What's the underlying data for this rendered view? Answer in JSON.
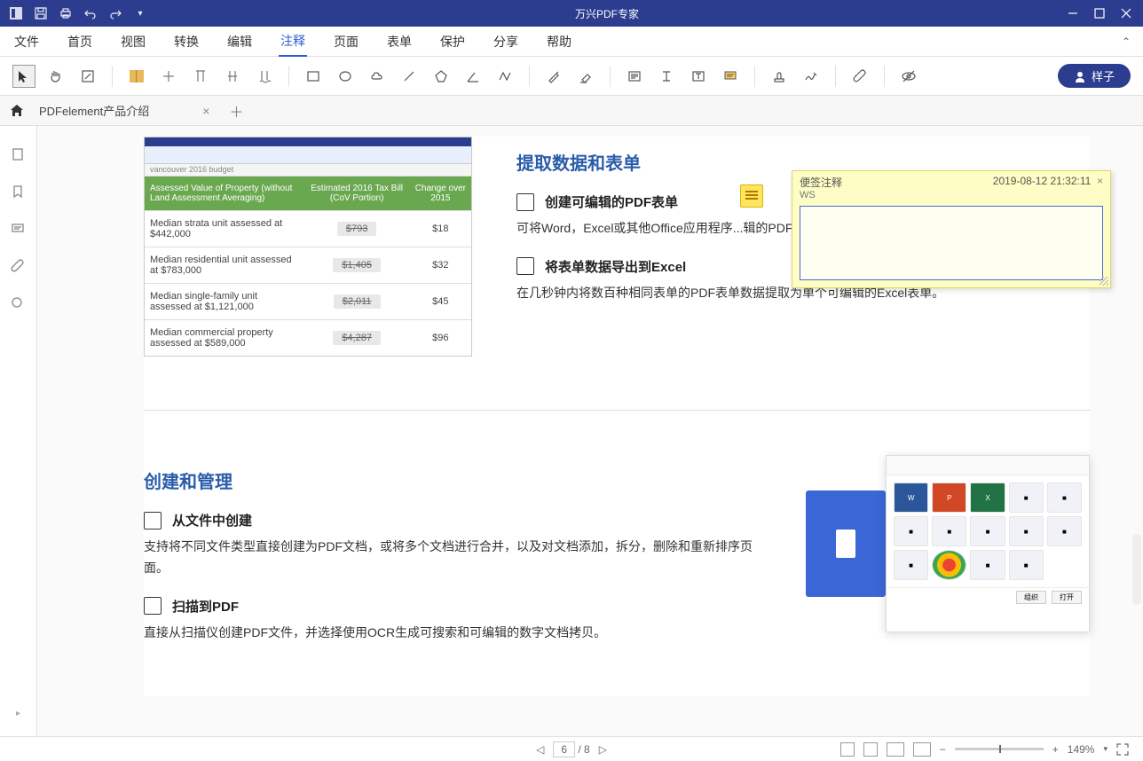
{
  "app_title": "万兴PDF专家",
  "menu": [
    "文件",
    "首页",
    "视图",
    "转换",
    "编辑",
    "注释",
    "页面",
    "表单",
    "保护",
    "分享",
    "帮助"
  ],
  "menu_active_index": 5,
  "user_label": "样子",
  "tab": {
    "name": "PDFelement产品介绍"
  },
  "sticky": {
    "title": "便签注释",
    "timestamp": "2019-08-12 21:32:11",
    "author": "WS",
    "text": ""
  },
  "content": {
    "section1_title": "提取数据和表单",
    "feat1": {
      "title": "创建可编辑的PDF表单",
      "desc": "可将Word，Excel或其他Office应用程序...辑的PDF。"
    },
    "feat2": {
      "title": "将表单数据导出到Excel",
      "desc": "在几秒钟内将数百种相同表单的PDF表单数据提取为单个可编辑的Excel表单。"
    },
    "section2_title": "创建和管理",
    "feat3": {
      "title": "从文件中创建",
      "desc": "支持将不同文件类型直接创建为PDF文档，或将多个文档进行合并，以及对文档添加，拆分，删除和重新排序页面。"
    },
    "feat4": {
      "title": "扫描到PDF",
      "desc": "直接从扫描仪创建PDF文件，并选择使用OCR生成可搜索和可编辑的数字文档拷贝。"
    }
  },
  "table": {
    "headers": [
      "Assessed Value of Property (without Land Assessment Averaging)",
      "Estimated 2016 Tax Bill (CoV Portion)",
      "Change over 2015"
    ],
    "rows": [
      {
        "label": "Median strata unit assessed at $442,000",
        "bill": "$793",
        "change": "$18"
      },
      {
        "label": "Median residential unit assessed at $783,000",
        "bill": "$1,405",
        "change": "$32"
      },
      {
        "label": "Median single-family unit assessed at $1,121,000",
        "bill": "$2,011",
        "change": "$45"
      },
      {
        "label": "Median commercial property assessed at $589,000",
        "bill": "$4,287",
        "change": "$96"
      }
    ]
  },
  "status": {
    "page_current": "6",
    "page_total": "/ 8",
    "zoom": "149%"
  },
  "file_icons": [
    "W",
    "P",
    "X",
    "■",
    "■",
    "■",
    "■",
    "■",
    "■",
    "■",
    "■",
    "●",
    "■",
    "■"
  ],
  "file_buttons": [
    "组织",
    "打开"
  ]
}
